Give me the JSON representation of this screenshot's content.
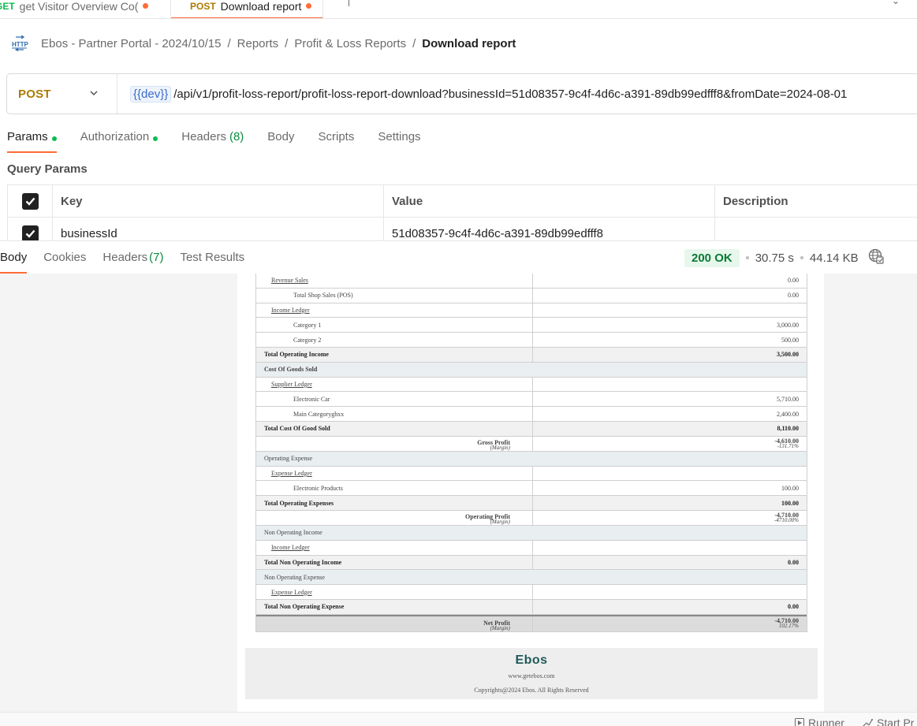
{
  "tabs": [
    {
      "method": "GET",
      "label": "get Visitor Overview Co("
    },
    {
      "method": "POST",
      "label": "Download report"
    }
  ],
  "breadcrumb": {
    "items": [
      "Ebos - Partner Portal - 2024/10/15",
      "Reports",
      "Profit & Loss Reports"
    ],
    "current": "Download report",
    "separator": "/"
  },
  "request": {
    "method": "POST",
    "url_variable": "{{dev}}",
    "url_path": "/api/v1/profit-loss-report/profit-loss-report-download?businessId=51d08357-9c4f-4d6c-a391-89db99edfff8&fromDate=2024-08-01"
  },
  "request_tabs": [
    {
      "label": "Params",
      "dot": true,
      "count": ""
    },
    {
      "label": "Authorization",
      "dot": true,
      "count": ""
    },
    {
      "label": "Headers",
      "dot": false,
      "count": "(8)"
    },
    {
      "label": "Body",
      "dot": false,
      "count": ""
    },
    {
      "label": "Scripts",
      "dot": false,
      "count": ""
    },
    {
      "label": "Settings",
      "dot": false,
      "count": ""
    }
  ],
  "query_params": {
    "title": "Query Params",
    "headers": {
      "key": "Key",
      "value": "Value",
      "description": "Description"
    },
    "rows": [
      {
        "key": "businessId",
        "value": "51d08357-9c4f-4d6c-a391-89db99edfff8",
        "description": ""
      }
    ]
  },
  "response_tabs": [
    {
      "label": "Body",
      "count": ""
    },
    {
      "label": "Cookies",
      "count": ""
    },
    {
      "label": "Headers",
      "count": "(7)"
    },
    {
      "label": "Test Results",
      "count": ""
    }
  ],
  "response_status": {
    "status": "200 OK",
    "time": "30.75 s",
    "size": "44.14 KB"
  },
  "report": {
    "rows": [
      {
        "kind": "ledger",
        "label": "Revenue Sales",
        "value": "0.00"
      },
      {
        "kind": "item",
        "label": "Total Shop Sales (POS)",
        "value": "0.00"
      },
      {
        "kind": "ledger",
        "label": "Income Ledger",
        "value": ""
      },
      {
        "kind": "item",
        "label": "Category 1",
        "value": "3,000.00"
      },
      {
        "kind": "item",
        "label": "Category 2",
        "value": "500.00"
      },
      {
        "kind": "total",
        "label": "Total Operating Income",
        "value": "3,500.00"
      },
      {
        "kind": "section-bold",
        "label": "Cost Of Goods Sold",
        "value": ""
      },
      {
        "kind": "ledger",
        "label": "Supplier Ledger",
        "value": ""
      },
      {
        "kind": "item",
        "label": "Electronic Car",
        "value": "5,710.00"
      },
      {
        "kind": "item",
        "label": "Main Categoryghxx",
        "value": "2,400.00"
      },
      {
        "kind": "total",
        "label": "Total Cost Of Good Sold",
        "value": "8,110.00"
      },
      {
        "kind": "profit",
        "label": "Gross Profit",
        "sublabel": "(Margin)",
        "value": "-4,610.00",
        "subvalue": "-131.71%"
      },
      {
        "kind": "section",
        "label": "Operating Expense",
        "value": ""
      },
      {
        "kind": "ledger",
        "label": "Expense Ledger",
        "value": ""
      },
      {
        "kind": "item",
        "label": "Electronic Products",
        "value": "100.00"
      },
      {
        "kind": "total",
        "label": "Total Operating Expenses",
        "value": "100.00"
      },
      {
        "kind": "profit",
        "label": "Operating Profit",
        "sublabel": "(Margin)",
        "value": "-4,710.00",
        "subvalue": "-4710.00%"
      },
      {
        "kind": "section",
        "label": "Non Operating Income",
        "value": ""
      },
      {
        "kind": "ledger",
        "label": "Income Ledger",
        "value": ""
      },
      {
        "kind": "total",
        "label": "Total Non Operating Income",
        "value": "0.00"
      },
      {
        "kind": "section",
        "label": "Non Operating Expense",
        "value": ""
      },
      {
        "kind": "ledger",
        "label": "Expense Ledger",
        "value": ""
      },
      {
        "kind": "total",
        "label": "Total Non Operating Expense",
        "value": "0.00"
      },
      {
        "kind": "net",
        "label": "Net Profit",
        "sublabel": "(Margin)",
        "value": "-4,710.00",
        "subvalue": "102.17%"
      }
    ],
    "footer": {
      "logo": "Ebos",
      "website": "www.getebos.com",
      "copyright": "Copyrights@2024 Ebos. All Rights Reserved"
    }
  },
  "status_bar": {
    "runner": "Runner",
    "start_proxy": "Start Pr"
  },
  "colors": {
    "accent": "#ff6c37",
    "post": "#ad7a03",
    "get": "#0cbb52",
    "status_ok": "#087a35"
  }
}
